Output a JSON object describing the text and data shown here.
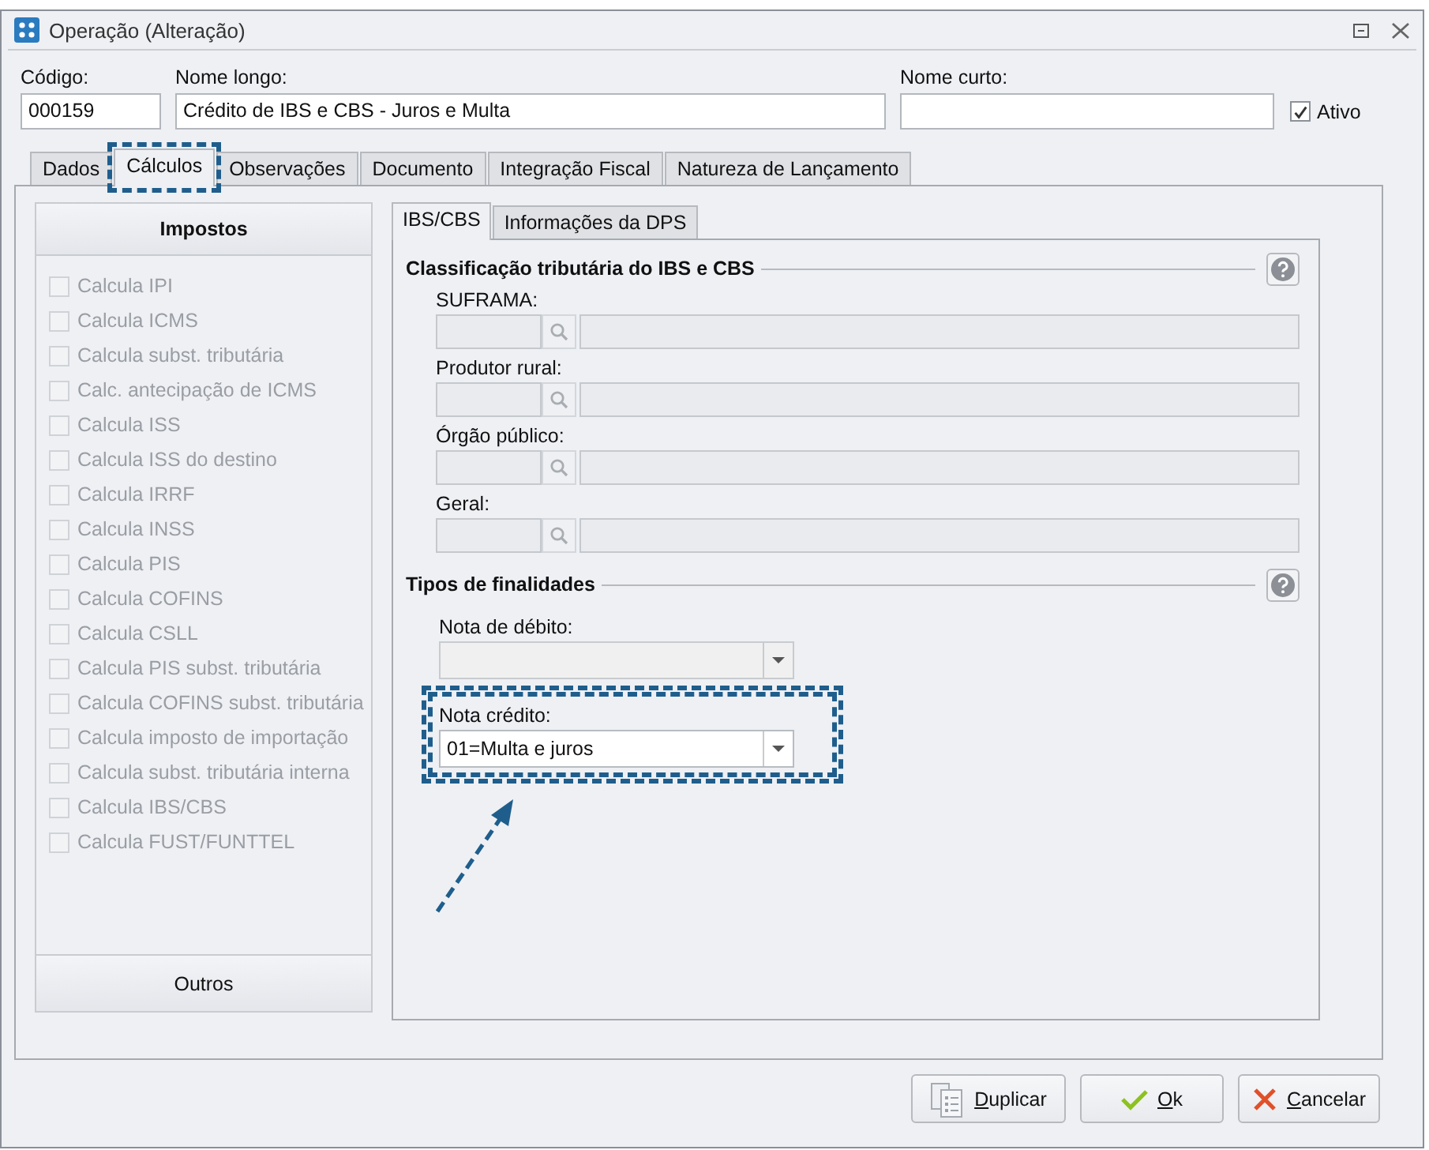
{
  "window": {
    "title": "Operação (Alteração)"
  },
  "fields": [
    {
      "label": "Código:",
      "value": "000159"
    },
    {
      "label": "Nome longo:",
      "value": "Crédito de IBS e CBS - Juros e Multa"
    },
    {
      "label": "Nome curto:"
    }
  ],
  "active_checkbox": {
    "label": "Ativo",
    "checked": true
  },
  "tabs": [
    {
      "label": "Dados",
      "selected": false,
      "highlighted": false
    },
    {
      "label": "Cálculos",
      "selected": true,
      "highlighted": true
    },
    {
      "label": "Observações",
      "selected": false,
      "highlighted": false
    },
    {
      "label": "Documento",
      "selected": false,
      "highlighted": false
    },
    {
      "label": "Integração Fiscal",
      "selected": false,
      "highlighted": false
    },
    {
      "label": "Natureza de Lançamento",
      "selected": false,
      "highlighted": false
    }
  ],
  "left_panel": {
    "header": "Impostos",
    "footer": "Outros",
    "items": [
      {
        "label": "Calcula IPI",
        "checked": false,
        "disabled": true
      },
      {
        "label": "Calcula ICMS",
        "checked": false,
        "disabled": true
      },
      {
        "label": "Calcula subst. tributária",
        "checked": false,
        "disabled": true
      },
      {
        "label": "Calc. antecipação de ICMS",
        "checked": false,
        "disabled": true
      },
      {
        "label": "Calcula ISS",
        "checked": false,
        "disabled": true
      },
      {
        "label": "Calcula ISS do destino",
        "checked": false,
        "disabled": true
      },
      {
        "label": "Calcula IRRF",
        "checked": false,
        "disabled": true
      },
      {
        "label": "Calcula INSS",
        "checked": false,
        "disabled": true
      },
      {
        "label": "Calcula PIS",
        "checked": false,
        "disabled": true
      },
      {
        "label": "Calcula COFINS",
        "checked": false,
        "disabled": true
      },
      {
        "label": "Calcula CSLL",
        "checked": false,
        "disabled": true
      },
      {
        "label": "Calcula PIS subst. tributária",
        "checked": false,
        "disabled": true
      },
      {
        "label": "Calcula COFINS subst. tributária",
        "checked": false,
        "disabled": true
      },
      {
        "label": "Calcula imposto de importação",
        "checked": false,
        "disabled": true
      },
      {
        "label": "Calcula subst. tributária interna",
        "checked": false,
        "disabled": true
      },
      {
        "label": "Calcula IBS/CBS",
        "checked": false,
        "disabled": true
      },
      {
        "label": "Calcula FUST/FUNTTEL",
        "checked": false,
        "disabled": true
      }
    ]
  },
  "inner_tabs": [
    {
      "label": "IBS/CBS",
      "selected": true
    },
    {
      "label": "Informações da DPS",
      "selected": false
    }
  ],
  "sections": [
    {
      "title": "Classificação tributária do IBS e CBS",
      "lookups": [
        {
          "label": "SUFRAMA:",
          "disabled": true
        },
        {
          "label": "Produtor rural:",
          "disabled": true
        },
        {
          "label": "Órgão público:",
          "disabled": true
        },
        {
          "label": "Geral:",
          "disabled": true
        }
      ]
    },
    {
      "title": "Tipos de finalidades",
      "dropdowns": [
        {
          "label": "Nota de débito:",
          "disabled": true,
          "highlighted": false
        },
        {
          "label": "Nota crédito:",
          "value": "01=Multa e juros",
          "disabled": false,
          "highlighted": true
        }
      ]
    }
  ],
  "annotation_arrow": true,
  "buttons": [
    {
      "label": "Duplicar",
      "kind": "duplicate"
    },
    {
      "label": "Ok",
      "kind": "ok"
    },
    {
      "label": "Cancelar",
      "kind": "cancel"
    }
  ]
}
